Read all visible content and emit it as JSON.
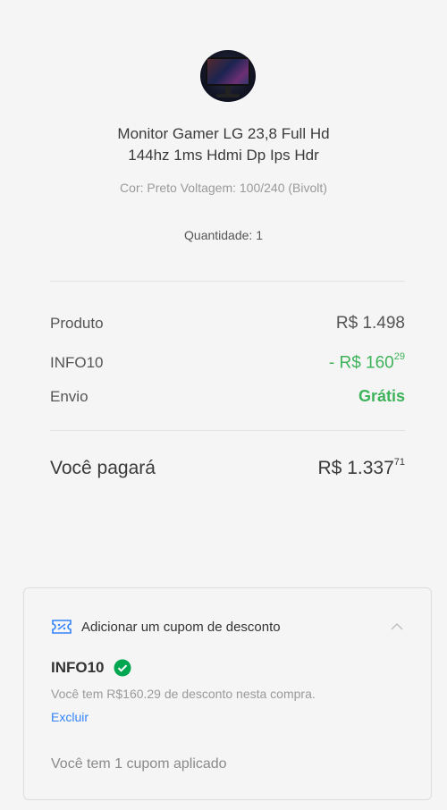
{
  "product": {
    "title_line1": "Monitor Gamer LG 23,8 Full Hd",
    "title_line2": "144hz 1ms Hdmi Dp Ips Hdr",
    "variant": "Cor: Preto Voltagem: 100/240 (Bivolt)",
    "quantity": "Quantidade: 1"
  },
  "summary": {
    "product_label": "Produto",
    "product_value": "R$ 1.498",
    "coupon_label": "INFO10",
    "coupon_value_main": "- R$ 160",
    "coupon_value_cents": "29",
    "shipping_label": "Envio",
    "shipping_value": "Grátis",
    "total_label": "Você pagará",
    "total_value_main": "R$ 1.337",
    "total_value_cents": "71"
  },
  "coupon": {
    "header": "Adicionar um cupom de desconto",
    "code": "INFO10",
    "message": "Você tem R$160.29 de desconto nesta compra.",
    "remove_label": "Excluir",
    "applied_text": "Você tem 1 cupom aplicado"
  },
  "colors": {
    "accent_green": "#3fb35a",
    "link_blue": "#3483fa",
    "check_green": "#00a650"
  },
  "icons": [
    "ticket-icon",
    "check-icon",
    "chevron-up-icon"
  ]
}
